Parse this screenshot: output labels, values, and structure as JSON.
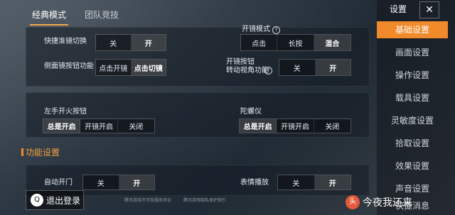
{
  "tabs": [
    {
      "label": "经典模式"
    },
    {
      "label": "团队竞技"
    }
  ],
  "classic": {
    "quick_scope": {
      "label": "快捷准镜切换",
      "options": [
        "关",
        "开"
      ]
    },
    "side_scope": {
      "label": "侧面镜按钮功能",
      "options": [
        "点击开镜",
        "点击切镜"
      ]
    },
    "fire_mode_partial": {
      "label": "开镜模式",
      "options": [
        "点击",
        "长按",
        "混合"
      ]
    },
    "scope_rotate": {
      "label": "开镜按钮\n转动视角功能",
      "options": [
        "关",
        "开"
      ]
    },
    "left_fire": {
      "label": "左手开火按钮",
      "options": [
        "总是开启",
        "开镜开启",
        "关闭"
      ]
    },
    "gyro": {
      "label": "陀螺仪",
      "options": [
        "总是开启",
        "开镜开启",
        "关闭"
      ]
    }
  },
  "function_settings": {
    "title": "功能设置",
    "auto_door": {
      "label": "自动开门",
      "options": [
        "关",
        "开"
      ]
    },
    "emote": {
      "label": "表情播放",
      "options": [
        "关",
        "开"
      ]
    }
  },
  "sidebar": {
    "title": "设置",
    "close": "✕",
    "items": [
      {
        "label": "基础设置"
      },
      {
        "label": "画面设置"
      },
      {
        "label": "操作设置"
      },
      {
        "label": "载具设置"
      },
      {
        "label": "灵敏度设置"
      },
      {
        "label": "拾取设置"
      },
      {
        "label": "效果设置"
      },
      {
        "label": "声音设置"
      },
      {
        "label": "快捷消息"
      }
    ]
  },
  "logout": {
    "label": "退出登录",
    "icon": "qq-icon"
  },
  "footer_notes": [
    "腾讯游戏许可及服务协议",
    "腾讯游戏隐私保护指引"
  ],
  "watermark": {
    "text": "今夜我还来",
    "icon": "toutiao-logo"
  }
}
